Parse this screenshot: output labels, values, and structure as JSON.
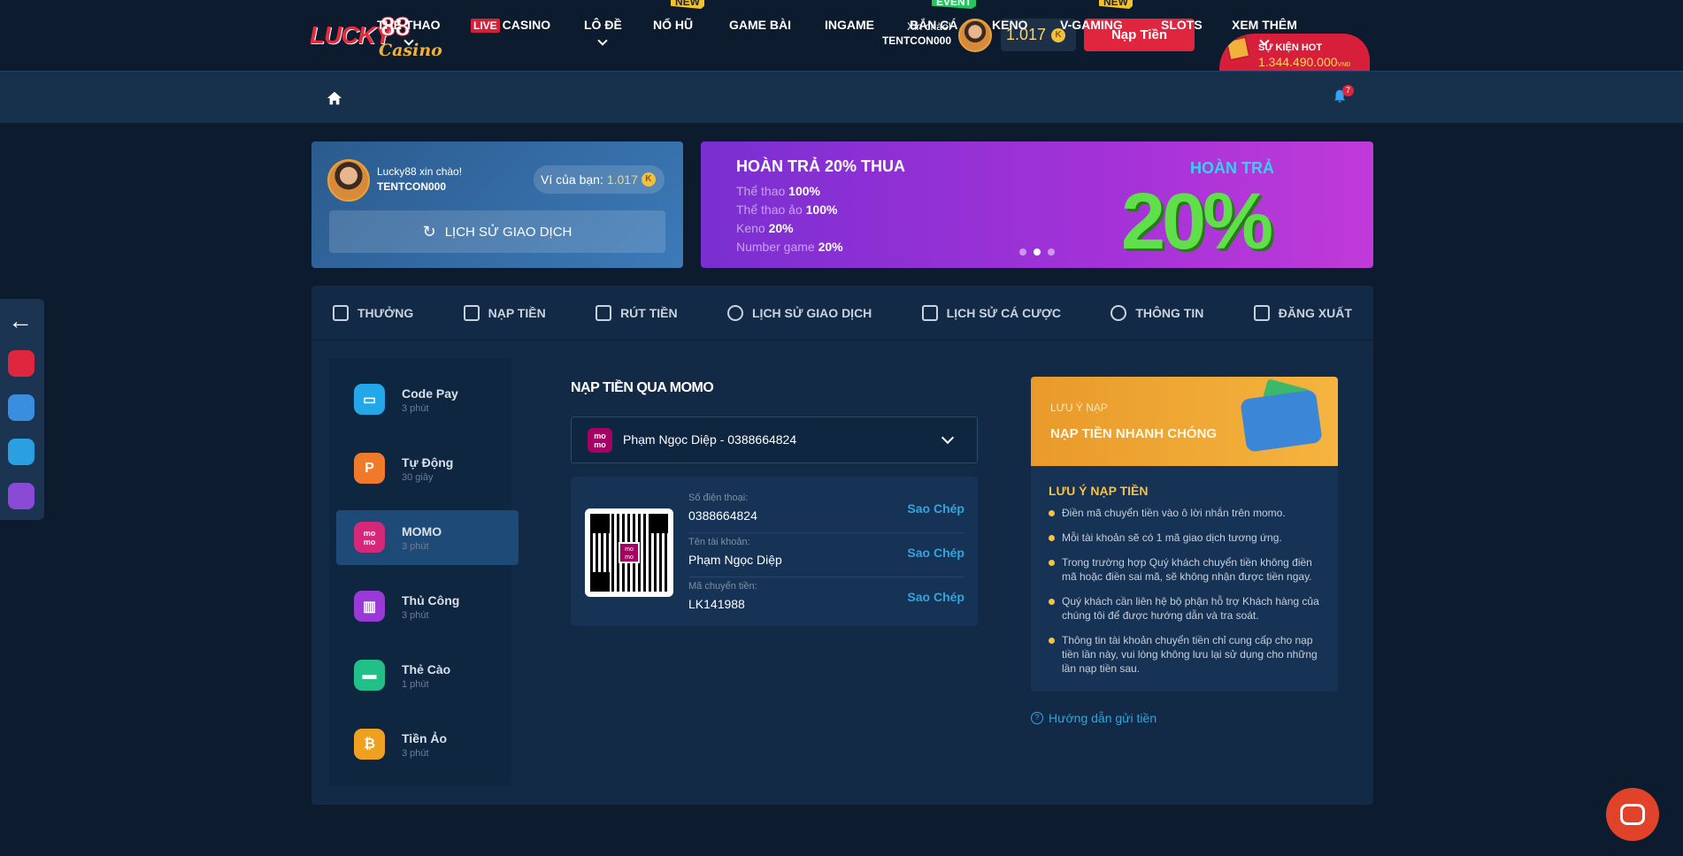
{
  "header": {
    "logo_word": "LUCKY",
    "logo_num": "88",
    "logo_sub": "Casino",
    "greeting": "Xin chào!",
    "username": "TENTCON000",
    "balance": "1.017",
    "deposit_button": "Nạp Tiền",
    "event_label": "SỰ KIỆN HOT",
    "event_amount": "1.344.490.000",
    "event_unit": "VNĐ"
  },
  "nav": {
    "items": [
      {
        "label": "THỂ THAO"
      },
      {
        "live": "LIVE",
        "label": "CASINO"
      },
      {
        "label": "LÔ ĐỀ"
      },
      {
        "label": "NỔ HŨ",
        "tag": "NEW"
      },
      {
        "label": "GAME BÀI"
      },
      {
        "label": "INGAME"
      },
      {
        "label": "BẮN CÁ",
        "tag": "EVENT"
      },
      {
        "label": "KENO"
      },
      {
        "label": "V-GAMING",
        "tag": "NEW"
      },
      {
        "label": "SLOTS"
      },
      {
        "label": "XEM THÊM"
      }
    ],
    "bell_count": "7"
  },
  "welcome": {
    "title": "Lucky88 xin chào!",
    "username": "TENTCON000",
    "wallet_label": "Ví của bạn:",
    "wallet_value": "1.017",
    "history_button": "LỊCH SỬ GIAO DỊCH"
  },
  "promo": {
    "title": "HOÀN TRẢ 20% THUA",
    "rows": [
      {
        "name": "Thể thao",
        "value": "100%"
      },
      {
        "name": "Thể thao ảo",
        "value": "100%"
      },
      {
        "name": "Keno",
        "value": "20%"
      },
      {
        "name": "Number game",
        "value": "20%"
      }
    ],
    "badge_title": "HOÀN TRẢ",
    "badge_value": "20%"
  },
  "tabs": [
    "THƯỞNG",
    "NẠP TIỀN",
    "RÚT TIỀN",
    "LỊCH SỬ GIAO DỊCH",
    "LỊCH SỬ CÁ CƯỢC",
    "THÔNG TIN",
    "ĐĂNG XUẤT"
  ],
  "methods": [
    {
      "name": "Code Pay",
      "time": "3 phút",
      "color": "#22a8e8"
    },
    {
      "name": "Tự Động",
      "time": "30 giây",
      "color": "#f07a2a"
    },
    {
      "name": "MOMO",
      "time": "3 phút",
      "color": "#d6287a"
    },
    {
      "name": "Thủ Công",
      "time": "3 phút",
      "color": "#9a3ad6"
    },
    {
      "name": "Thẻ Cào",
      "time": "1 phút",
      "color": "#22c088"
    },
    {
      "name": "Tiền Ảo",
      "time": "3 phút",
      "color": "#f0a020"
    }
  ],
  "content": {
    "title": "NẠP TIỀN QUA MOMO",
    "momo": "mo mo",
    "selected_account": "Phạm Ngọc Diệp - 0388664824",
    "fields": [
      {
        "label": "Số điện thoại:",
        "value": "0388664824",
        "copy": "Sao Chép"
      },
      {
        "label": "Tên tài khoản:",
        "value": "Phạm Ngọc Diệp",
        "copy": "Sao Chép"
      },
      {
        "label": "Mã chuyển tiền:",
        "value": "LK141988",
        "copy": "Sao Chép"
      }
    ]
  },
  "note": {
    "banner_sub": "LƯU Ý NẠP",
    "banner_title": "NẠP TIỀN NHANH CHÓNG",
    "title": "LƯU Ý NẠP TIỀN",
    "items": [
      "Điền mã chuyển tiền vào ô lời nhắn trên momo.",
      "Mỗi tài khoản sẽ có 1 mã giao dịch tương ứng.",
      "Trong trường hợp Quý khách chuyển tiền không điền mã hoặc điền sai mã, sẽ không nhận được tiền ngay.",
      "Quý khách cần liên hệ bộ phận hỗ trợ Khách hàng của chúng tôi để được hướng dẫn và tra soát.",
      "Thông tin tài khoản chuyển tiền chỉ cung cấp cho nạp tiền lần này, vui lòng không lưu lại sử dụng cho những lần nạp tiền sau."
    ],
    "guide": "Hướng dẫn gửi tiền"
  }
}
